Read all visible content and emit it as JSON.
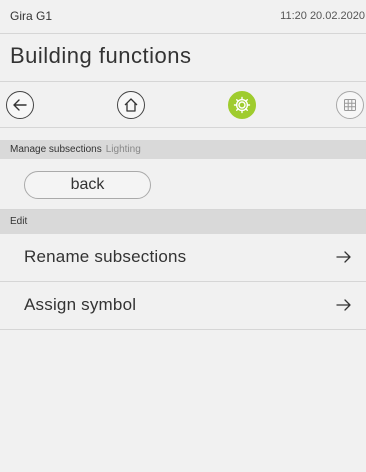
{
  "status_bar": {
    "device_name": "Gira G1",
    "datetime": "11:20 20.02.2020"
  },
  "page": {
    "title": "Building functions"
  },
  "nav": {
    "back_icon": "arrow-left-icon",
    "home_icon": "home-icon",
    "settings_icon": "gear-icon",
    "grid_icon": "grid-icon",
    "active_color": "#9fcc2e"
  },
  "sections": {
    "manage": {
      "label": "Manage subsections",
      "sublabel": "Lighting"
    },
    "back_label": "back",
    "edit": {
      "label": "Edit"
    }
  },
  "items": [
    {
      "label": "Rename subsections",
      "icon": "arrow-right-icon"
    },
    {
      "label": "Assign symbol",
      "icon": "arrow-right-icon"
    }
  ]
}
